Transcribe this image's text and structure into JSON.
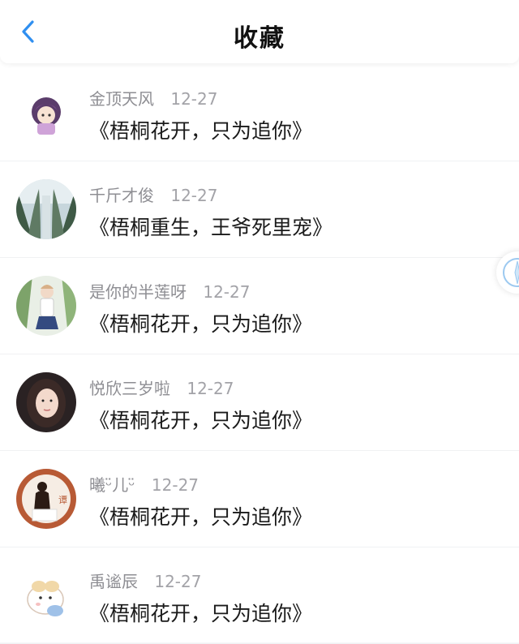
{
  "header": {
    "title": "收藏"
  },
  "items": [
    {
      "name": "金顶天风",
      "date": "12-27",
      "book": "《梧桐花开，只为追你》"
    },
    {
      "name": "千斤才俊",
      "date": "12-27",
      "book": "《梧桐重生，王爷死里宠》"
    },
    {
      "name": "是你的半莲呀",
      "date": "12-27",
      "book": "《梧桐花开，只为追你》"
    },
    {
      "name": "悦欣三岁啦",
      "date": "12-27",
      "book": "《梧桐花开，只为追你》"
    },
    {
      "name": "曦ᵕ̈儿ᵕ̈",
      "date": "12-27",
      "book": "《梧桐花开，只为追你》"
    },
    {
      "name": "禹谧辰",
      "date": "12-27",
      "book": "《梧桐花开，只为追你》"
    }
  ],
  "avatar_badge_text": "谭",
  "colors": {
    "accent": "#2f8ff0"
  }
}
